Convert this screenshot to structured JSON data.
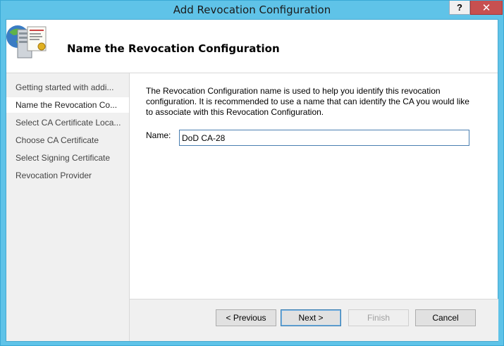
{
  "window": {
    "title": "Add Revocation Configuration",
    "help_label": "?",
    "close_label": "✕"
  },
  "header": {
    "title": "Name the Revocation Configuration",
    "icon": "server-certificate-icon"
  },
  "sidebar": {
    "items": [
      {
        "label": "Getting started with addi...",
        "active": false
      },
      {
        "label": "Name the Revocation Co...",
        "active": true
      },
      {
        "label": "Select CA Certificate Loca...",
        "active": false
      },
      {
        "label": "Choose CA Certificate",
        "active": false
      },
      {
        "label": "Select Signing Certificate",
        "active": false
      },
      {
        "label": "Revocation Provider",
        "active": false
      }
    ]
  },
  "main": {
    "description": "The Revocation Configuration name is used to help you identify this revocation configuration. It is recommended to use a name that can identify the CA you would like to associate with this Revocation Configuration.",
    "name_label": "Name:",
    "name_value": "DoD CA-28"
  },
  "footer": {
    "previous_label": "< Previous",
    "next_label": "Next >",
    "finish_label": "Finish",
    "cancel_label": "Cancel"
  }
}
